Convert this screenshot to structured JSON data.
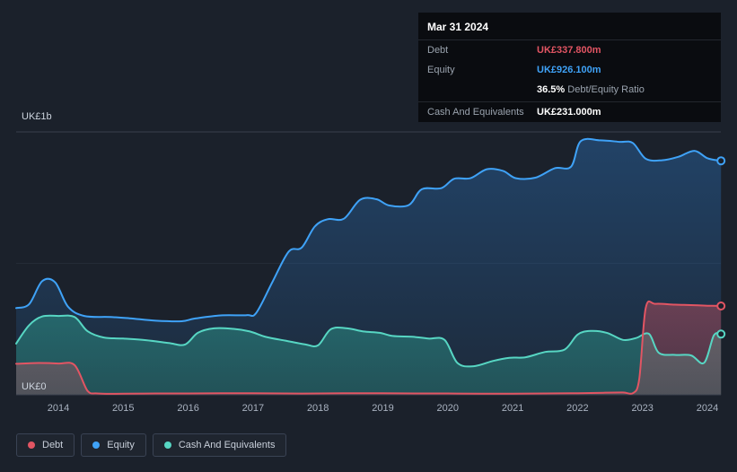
{
  "tooltip": {
    "date": "Mar 31 2024",
    "rows": [
      {
        "label": "Debt",
        "value": "UK£337.800m",
        "color": "#e25563"
      },
      {
        "label": "Equity",
        "value": "UK£926.100m",
        "color": "#3fa2f7"
      },
      {
        "label": "Cash And Equivalents",
        "value": "UK£231.000m",
        "color": "#ffffff"
      }
    ],
    "ratio_value": "36.5%",
    "ratio_label": "Debt/Equity Ratio"
  },
  "axis": {
    "y_top_label": "UK£1b",
    "y_bottom_label": "UK£0"
  },
  "legend": {
    "items": [
      {
        "label": "Debt",
        "color": "#e25563"
      },
      {
        "label": "Equity",
        "color": "#3fa2f7"
      },
      {
        "label": "Cash And Equivalents",
        "color": "#57d6c3"
      }
    ]
  },
  "colors": {
    "background": "#1b212b",
    "grid": "#39404d",
    "debt": "#e25563",
    "equity": "#3fa2f7",
    "cash": "#57d6c3"
  },
  "chart_data": {
    "type": "area",
    "title": "Debt, Equity and Cash history",
    "unit": "UK£ millions",
    "ylim": [
      0,
      1000
    ],
    "y_tick_labels": [
      "UK£0",
      "UK£1b"
    ],
    "grid": true,
    "legend_position": "bottom-left",
    "x_tick_years": [
      2014,
      2015,
      2016,
      2017,
      2018,
      2019,
      2020,
      2021,
      2022,
      2023,
      2024
    ],
    "x_tick_labels": [
      "2014",
      "2015",
      "2016",
      "2017",
      "2018",
      "2019",
      "2020",
      "2021",
      "2022",
      "2023",
      "2024"
    ],
    "latest": {
      "date": "Mar 31 2024",
      "debt_m": 337.8,
      "equity_m": 926.1,
      "cash_m": 231.0,
      "debt_equity_ratio_pct": 36.5
    },
    "series": [
      {
        "id": "equity",
        "name": "Equity",
        "color": "#3fa2f7",
        "points": [
          [
            2013.35,
            330
          ],
          [
            2013.55,
            345
          ],
          [
            2013.75,
            432
          ],
          [
            2013.95,
            428
          ],
          [
            2014.15,
            335
          ],
          [
            2014.4,
            300
          ],
          [
            2014.8,
            296
          ],
          [
            2015.1,
            291
          ],
          [
            2015.5,
            282
          ],
          [
            2015.9,
            280
          ],
          [
            2016.1,
            290
          ],
          [
            2016.5,
            302
          ],
          [
            2016.9,
            303
          ],
          [
            2017.05,
            312
          ],
          [
            2017.3,
            430
          ],
          [
            2017.55,
            545
          ],
          [
            2017.75,
            560
          ],
          [
            2017.95,
            640
          ],
          [
            2018.15,
            668
          ],
          [
            2018.4,
            670
          ],
          [
            2018.65,
            742
          ],
          [
            2018.9,
            744
          ],
          [
            2019.1,
            720
          ],
          [
            2019.4,
            722
          ],
          [
            2019.6,
            782
          ],
          [
            2019.9,
            786
          ],
          [
            2020.1,
            822
          ],
          [
            2020.35,
            824
          ],
          [
            2020.6,
            858
          ],
          [
            2020.85,
            852
          ],
          [
            2021.05,
            824
          ],
          [
            2021.35,
            826
          ],
          [
            2021.65,
            862
          ],
          [
            2021.9,
            868
          ],
          [
            2022.05,
            965
          ],
          [
            2022.35,
            968
          ],
          [
            2022.65,
            962
          ],
          [
            2022.85,
            958
          ],
          [
            2023.05,
            898
          ],
          [
            2023.3,
            892
          ],
          [
            2023.55,
            905
          ],
          [
            2023.8,
            928
          ],
          [
            2024.0,
            900
          ],
          [
            2024.21,
            890
          ]
        ]
      },
      {
        "id": "cash",
        "name": "Cash And Equivalents",
        "color": "#57d6c3",
        "points": [
          [
            2013.35,
            195
          ],
          [
            2013.55,
            265
          ],
          [
            2013.75,
            298
          ],
          [
            2014.0,
            300
          ],
          [
            2014.25,
            296
          ],
          [
            2014.45,
            242
          ],
          [
            2014.7,
            218
          ],
          [
            2015.0,
            214
          ],
          [
            2015.35,
            208
          ],
          [
            2015.7,
            197
          ],
          [
            2015.95,
            191
          ],
          [
            2016.15,
            236
          ],
          [
            2016.4,
            253
          ],
          [
            2016.7,
            251
          ],
          [
            2016.95,
            241
          ],
          [
            2017.2,
            220
          ],
          [
            2017.5,
            206
          ],
          [
            2017.8,
            192
          ],
          [
            2018.0,
            188
          ],
          [
            2018.2,
            250
          ],
          [
            2018.45,
            253
          ],
          [
            2018.7,
            241
          ],
          [
            2018.95,
            236
          ],
          [
            2019.15,
            224
          ],
          [
            2019.45,
            221
          ],
          [
            2019.7,
            214
          ],
          [
            2019.95,
            209
          ],
          [
            2020.15,
            121
          ],
          [
            2020.4,
            109
          ],
          [
            2020.7,
            129
          ],
          [
            2020.95,
            141
          ],
          [
            2021.2,
            143
          ],
          [
            2021.5,
            163
          ],
          [
            2021.8,
            172
          ],
          [
            2022.0,
            229
          ],
          [
            2022.2,
            243
          ],
          [
            2022.45,
            236
          ],
          [
            2022.7,
            209
          ],
          [
            2022.9,
            216
          ],
          [
            2023.1,
            232
          ],
          [
            2023.25,
            160
          ],
          [
            2023.5,
            152
          ],
          [
            2023.75,
            150
          ],
          [
            2023.95,
            122
          ],
          [
            2024.1,
            226
          ],
          [
            2024.21,
            231
          ]
        ]
      },
      {
        "id": "debt",
        "name": "Debt",
        "color": "#e25563",
        "points": [
          [
            2013.35,
            118
          ],
          [
            2013.7,
            121
          ],
          [
            2014.0,
            119
          ],
          [
            2014.25,
            113
          ],
          [
            2014.45,
            15
          ],
          [
            2014.6,
            5
          ],
          [
            2015.0,
            4
          ],
          [
            2015.5,
            5
          ],
          [
            2016.0,
            5
          ],
          [
            2016.5,
            6
          ],
          [
            2017.0,
            6
          ],
          [
            2017.5,
            5
          ],
          [
            2018.0,
            5
          ],
          [
            2018.5,
            6
          ],
          [
            2019.0,
            6
          ],
          [
            2019.5,
            5
          ],
          [
            2020.0,
            5
          ],
          [
            2020.5,
            4
          ],
          [
            2021.0,
            4
          ],
          [
            2021.5,
            5
          ],
          [
            2022.0,
            6
          ],
          [
            2022.4,
            8
          ],
          [
            2022.7,
            9
          ],
          [
            2022.85,
            6
          ],
          [
            2022.95,
            60
          ],
          [
            2023.05,
            330
          ],
          [
            2023.2,
            346
          ],
          [
            2023.5,
            343
          ],
          [
            2023.8,
            341
          ],
          [
            2024.0,
            339
          ],
          [
            2024.21,
            338
          ]
        ]
      }
    ]
  }
}
